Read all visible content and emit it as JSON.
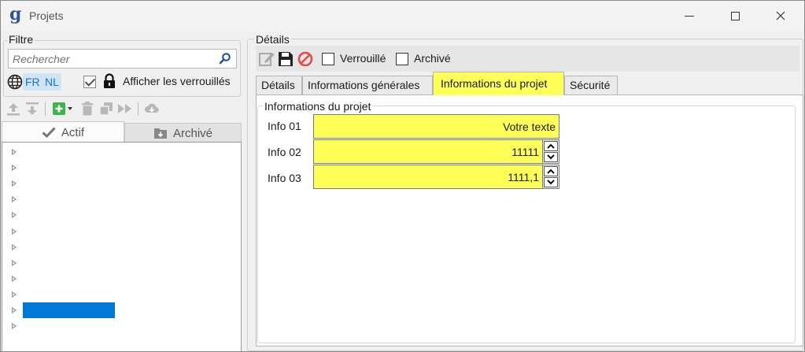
{
  "window": {
    "app_icon_letter": "g",
    "title": "Projets"
  },
  "filter": {
    "legend": "Filtre",
    "search_placeholder": "Rechercher",
    "lang_fr": "FR",
    "lang_nl": "NL",
    "show_locked_label": "Afficher les verrouillés",
    "show_locked_checked": true
  },
  "left_tabs": {
    "actif": "Actif",
    "archive": "Archivé"
  },
  "tree": {
    "row_count": 12,
    "selected_index": 10
  },
  "details": {
    "legend": "Détails",
    "verrouille_label": "Verrouillé",
    "archive_label": "Archivé",
    "tabs": [
      "Détails",
      "Informations générales",
      "Informations du projet",
      "Sécurité"
    ],
    "active_tab": "Informations du projet"
  },
  "info_projet": {
    "legend": "Informations du projet",
    "fields": [
      {
        "label": "Info 01",
        "value": "Votre texte"
      },
      {
        "label": "Info 02",
        "value": "11111"
      },
      {
        "label": "Info 03",
        "value": "1111,1"
      }
    ]
  },
  "colors": {
    "highlight": "#ffff5a",
    "selection": "#0078d7",
    "lang_bg": "#cfe4f7",
    "delete_red": "#e24b4b",
    "add_green": "#3cb54a"
  }
}
